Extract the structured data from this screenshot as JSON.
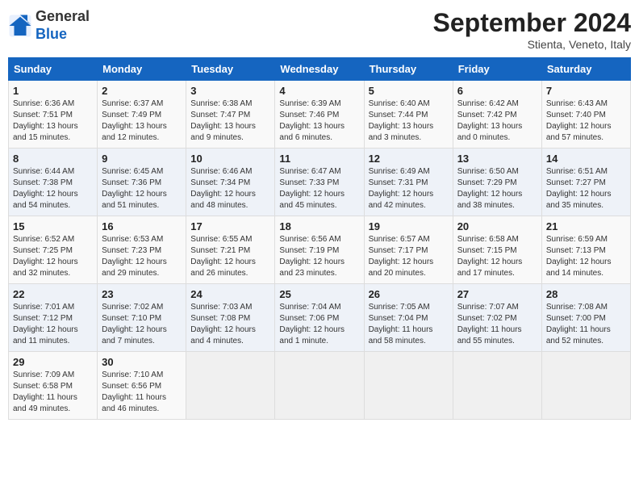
{
  "header": {
    "logo_line1": "General",
    "logo_line2": "Blue",
    "month_title": "September 2024",
    "location": "Stienta, Veneto, Italy"
  },
  "columns": [
    "Sunday",
    "Monday",
    "Tuesday",
    "Wednesday",
    "Thursday",
    "Friday",
    "Saturday"
  ],
  "weeks": [
    [
      {
        "day": "1",
        "info": "Sunrise: 6:36 AM\nSunset: 7:51 PM\nDaylight: 13 hours\nand 15 minutes."
      },
      {
        "day": "2",
        "info": "Sunrise: 6:37 AM\nSunset: 7:49 PM\nDaylight: 13 hours\nand 12 minutes."
      },
      {
        "day": "3",
        "info": "Sunrise: 6:38 AM\nSunset: 7:47 PM\nDaylight: 13 hours\nand 9 minutes."
      },
      {
        "day": "4",
        "info": "Sunrise: 6:39 AM\nSunset: 7:46 PM\nDaylight: 13 hours\nand 6 minutes."
      },
      {
        "day": "5",
        "info": "Sunrise: 6:40 AM\nSunset: 7:44 PM\nDaylight: 13 hours\nand 3 minutes."
      },
      {
        "day": "6",
        "info": "Sunrise: 6:42 AM\nSunset: 7:42 PM\nDaylight: 13 hours\nand 0 minutes."
      },
      {
        "day": "7",
        "info": "Sunrise: 6:43 AM\nSunset: 7:40 PM\nDaylight: 12 hours\nand 57 minutes."
      }
    ],
    [
      {
        "day": "8",
        "info": "Sunrise: 6:44 AM\nSunset: 7:38 PM\nDaylight: 12 hours\nand 54 minutes."
      },
      {
        "day": "9",
        "info": "Sunrise: 6:45 AM\nSunset: 7:36 PM\nDaylight: 12 hours\nand 51 minutes."
      },
      {
        "day": "10",
        "info": "Sunrise: 6:46 AM\nSunset: 7:34 PM\nDaylight: 12 hours\nand 48 minutes."
      },
      {
        "day": "11",
        "info": "Sunrise: 6:47 AM\nSunset: 7:33 PM\nDaylight: 12 hours\nand 45 minutes."
      },
      {
        "day": "12",
        "info": "Sunrise: 6:49 AM\nSunset: 7:31 PM\nDaylight: 12 hours\nand 42 minutes."
      },
      {
        "day": "13",
        "info": "Sunrise: 6:50 AM\nSunset: 7:29 PM\nDaylight: 12 hours\nand 38 minutes."
      },
      {
        "day": "14",
        "info": "Sunrise: 6:51 AM\nSunset: 7:27 PM\nDaylight: 12 hours\nand 35 minutes."
      }
    ],
    [
      {
        "day": "15",
        "info": "Sunrise: 6:52 AM\nSunset: 7:25 PM\nDaylight: 12 hours\nand 32 minutes."
      },
      {
        "day": "16",
        "info": "Sunrise: 6:53 AM\nSunset: 7:23 PM\nDaylight: 12 hours\nand 29 minutes."
      },
      {
        "day": "17",
        "info": "Sunrise: 6:55 AM\nSunset: 7:21 PM\nDaylight: 12 hours\nand 26 minutes."
      },
      {
        "day": "18",
        "info": "Sunrise: 6:56 AM\nSunset: 7:19 PM\nDaylight: 12 hours\nand 23 minutes."
      },
      {
        "day": "19",
        "info": "Sunrise: 6:57 AM\nSunset: 7:17 PM\nDaylight: 12 hours\nand 20 minutes."
      },
      {
        "day": "20",
        "info": "Sunrise: 6:58 AM\nSunset: 7:15 PM\nDaylight: 12 hours\nand 17 minutes."
      },
      {
        "day": "21",
        "info": "Sunrise: 6:59 AM\nSunset: 7:13 PM\nDaylight: 12 hours\nand 14 minutes."
      }
    ],
    [
      {
        "day": "22",
        "info": "Sunrise: 7:01 AM\nSunset: 7:12 PM\nDaylight: 12 hours\nand 11 minutes."
      },
      {
        "day": "23",
        "info": "Sunrise: 7:02 AM\nSunset: 7:10 PM\nDaylight: 12 hours\nand 7 minutes."
      },
      {
        "day": "24",
        "info": "Sunrise: 7:03 AM\nSunset: 7:08 PM\nDaylight: 12 hours\nand 4 minutes."
      },
      {
        "day": "25",
        "info": "Sunrise: 7:04 AM\nSunset: 7:06 PM\nDaylight: 12 hours\nand 1 minute."
      },
      {
        "day": "26",
        "info": "Sunrise: 7:05 AM\nSunset: 7:04 PM\nDaylight: 11 hours\nand 58 minutes."
      },
      {
        "day": "27",
        "info": "Sunrise: 7:07 AM\nSunset: 7:02 PM\nDaylight: 11 hours\nand 55 minutes."
      },
      {
        "day": "28",
        "info": "Sunrise: 7:08 AM\nSunset: 7:00 PM\nDaylight: 11 hours\nand 52 minutes."
      }
    ],
    [
      {
        "day": "29",
        "info": "Sunrise: 7:09 AM\nSunset: 6:58 PM\nDaylight: 11 hours\nand 49 minutes."
      },
      {
        "day": "30",
        "info": "Sunrise: 7:10 AM\nSunset: 6:56 PM\nDaylight: 11 hours\nand 46 minutes."
      },
      {
        "day": "",
        "info": ""
      },
      {
        "day": "",
        "info": ""
      },
      {
        "day": "",
        "info": ""
      },
      {
        "day": "",
        "info": ""
      },
      {
        "day": "",
        "info": ""
      }
    ]
  ]
}
